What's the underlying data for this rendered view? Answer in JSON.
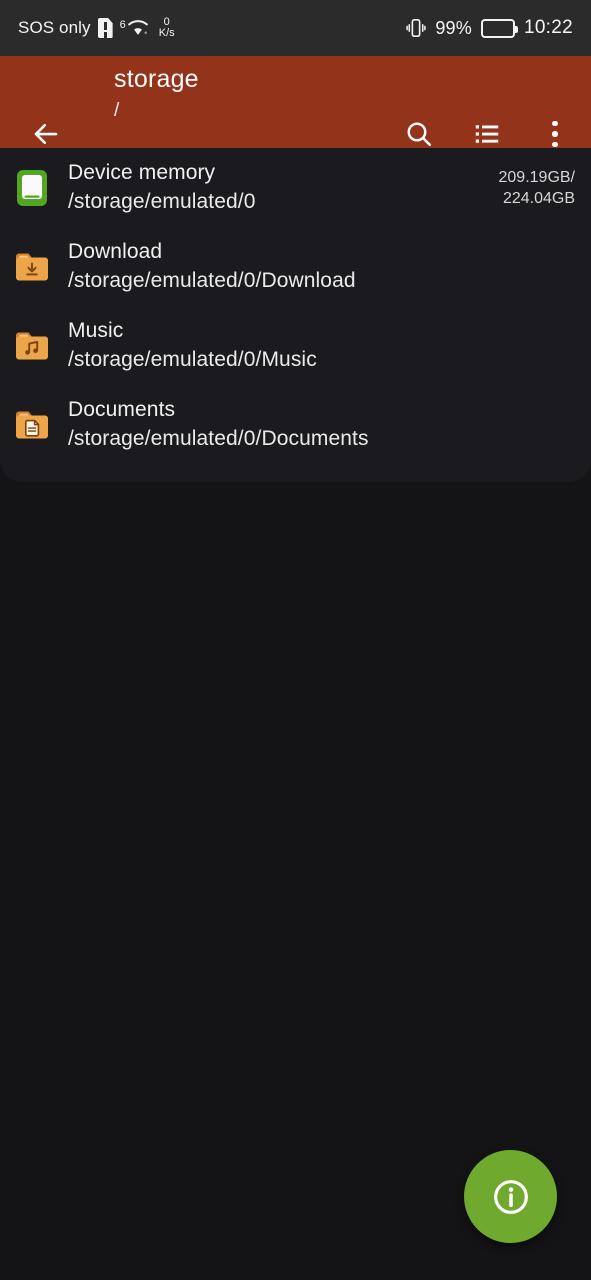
{
  "statusbar": {
    "carrier": "SOS only",
    "sim_icon": "sim-alert-icon",
    "wifi_icon": "wifi-icon",
    "wifi_generation": "6",
    "network_speed_value": "0",
    "network_speed_unit": "K/s",
    "vibrate_icon": "vibrate-icon",
    "battery_percent": "99%",
    "battery_icon": "battery-icon",
    "clock": "10:22"
  },
  "appbar": {
    "back_icon": "arrow-left-icon",
    "title": "storage",
    "subtitle": "/",
    "marker_icon": "triangle-marker-icon",
    "search_icon": "search-icon",
    "view_list_icon": "list-view-icon",
    "overflow_icon": "more-vertical-icon",
    "background_color": "#93331a"
  },
  "list": [
    {
      "icon": "device-memory-icon",
      "name": "Device memory",
      "path": "/storage/emulated/0",
      "size": "209.19GB/\n224.04GB"
    },
    {
      "icon": "folder-download-icon",
      "name": "Download",
      "path": "/storage/emulated/0/Download",
      "size": ""
    },
    {
      "icon": "folder-music-icon",
      "name": "Music",
      "path": "/storage/emulated/0/Music",
      "size": ""
    },
    {
      "icon": "folder-documents-icon",
      "name": "Documents",
      "path": "/storage/emulated/0/Documents",
      "size": ""
    }
  ],
  "fab": {
    "icon": "info-icon",
    "color": "#6faa2e"
  }
}
